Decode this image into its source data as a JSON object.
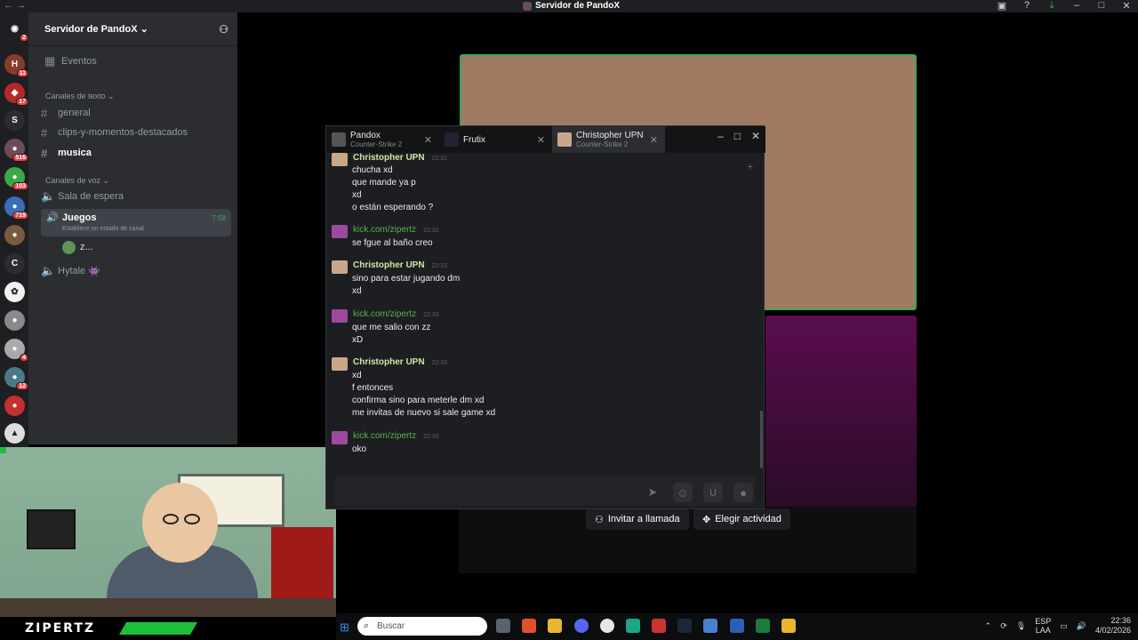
{
  "window": {
    "title": "Servidor de PandoX",
    "back": "←",
    "fwd": "→"
  },
  "server": {
    "name": "Servidor de PandoX ⌄",
    "events": "Eventos",
    "text_cat": "Canales de texto ⌄",
    "voice_cat": "Canales de voz ⌄"
  },
  "channels": {
    "text": [
      "general",
      "clips-y-momentos-destacados",
      "musica"
    ],
    "voice": {
      "sala": "Sala de espera",
      "juegos": "Juegos",
      "juegos_status": "Establece un estado de canal",
      "juegos_time": "7:58",
      "member": "z...",
      "hytale": "Hytale"
    }
  },
  "guild_badges": [
    "2",
    "11",
    "17",
    "516",
    "103",
    "719",
    "4",
    "12"
  ],
  "guild_letters": [
    "S",
    "C"
  ],
  "streamer": {
    "name": "ZIPERTZ"
  },
  "call": {
    "invite": "Invitar a llamada",
    "activity": "Elegir actividad"
  },
  "chat": {
    "tabs": [
      {
        "name": "Pandox",
        "game": "Counter-Strike 2"
      },
      {
        "name": "Frutix",
        "game": ""
      },
      {
        "name": "Christopher UPN",
        "game": "Counter-Strike 2"
      }
    ],
    "messages": [
      {
        "author": "Christopher UPN",
        "time": "22:32",
        "lines": [
          "chucha xd",
          "que mande ya p",
          "xd",
          "o están esperando ?"
        ]
      },
      {
        "author": "kick.com/zipertz",
        "time": "22:32",
        "lines": [
          "se fgue al baño creo"
        ]
      },
      {
        "author": "Christopher UPN",
        "time": "22:33",
        "lines": [
          "sino para estar jugando dm",
          "xd"
        ]
      },
      {
        "author": "kick.com/zipertz",
        "time": "22:33",
        "lines": [
          "que me salio con zz",
          "xD"
        ]
      },
      {
        "author": "Christopher UPN",
        "time": "22:33",
        "lines": [
          "xd",
          "f entonces",
          "confirma sino para meterle dm xd",
          "me invitas de nuevo si sale game xd"
        ]
      },
      {
        "author": "kick.com/zipertz",
        "time": "22:35",
        "lines": [
          "oko"
        ]
      }
    ]
  },
  "taskbar": {
    "search": "Buscar",
    "lang1": "ESP",
    "lang2": "LAA",
    "time": "22:36",
    "date": "4/02/2026"
  },
  "colors": {
    "accent": "#3ba55d",
    "discord_bg": "#2b2d31",
    "chat_bg": "#1d1e21"
  }
}
